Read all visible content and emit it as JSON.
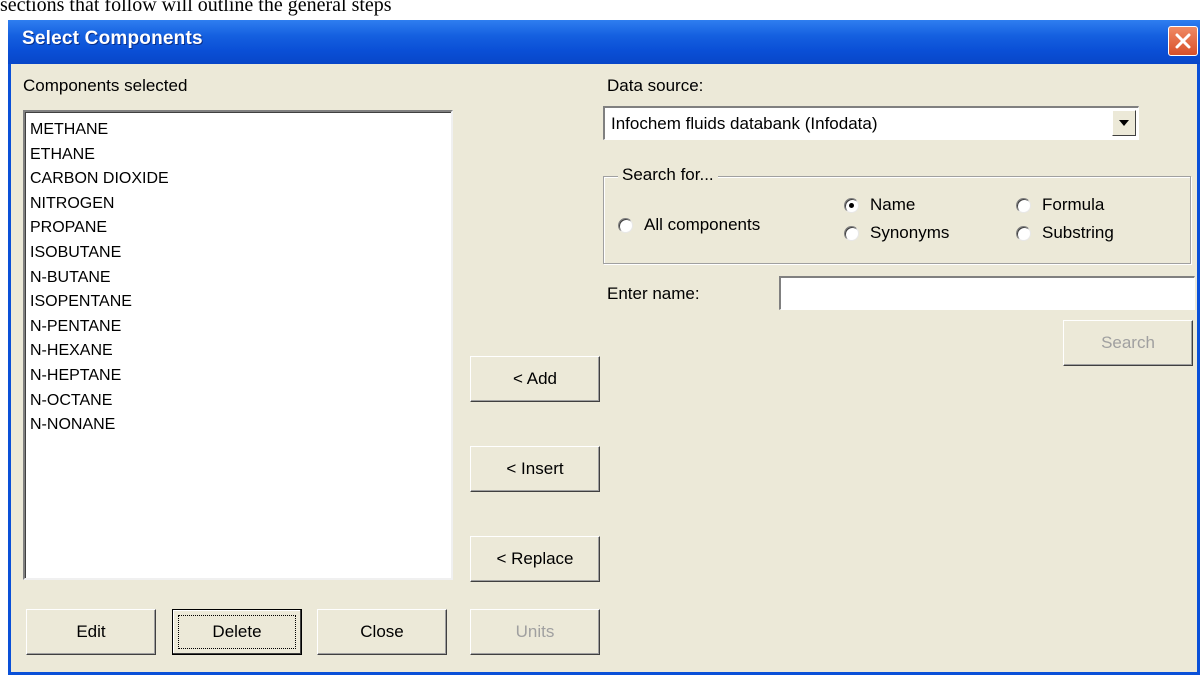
{
  "background_text": "sections that follow will outline the general steps",
  "window": {
    "title": "Select Components",
    "close_icon": "close-icon"
  },
  "components": {
    "label": "Components selected",
    "items": [
      "METHANE",
      "ETHANE",
      "CARBON DIOXIDE",
      "NITROGEN",
      "PROPANE",
      "ISOBUTANE",
      "N-BUTANE",
      "ISOPENTANE",
      "N-PENTANE",
      "N-HEXANE",
      "N-HEPTANE",
      "N-OCTANE",
      "N-NONANE"
    ]
  },
  "middle_buttons": {
    "add": "< Add",
    "insert": "< Insert",
    "replace": "< Replace"
  },
  "bottom_buttons": {
    "edit": "Edit",
    "delete": "Delete",
    "close": "Close",
    "units": "Units"
  },
  "data_source": {
    "label": "Data source:",
    "selected": "Infochem fluids databank (Infodata)"
  },
  "search": {
    "group_title": "Search for...",
    "options": {
      "all": "All components",
      "name": "Name",
      "synonyms": "Synonyms",
      "formula": "Formula",
      "substring": "Substring"
    },
    "selected": "Name",
    "enter_name_label": "Enter name:",
    "enter_name_value": "",
    "search_button": "Search"
  },
  "colors": {
    "titlebar": "#0a50d8",
    "dialog_face": "#ece9d8",
    "close_button": "#d8502a",
    "disabled_text": "#a0a0a0"
  }
}
